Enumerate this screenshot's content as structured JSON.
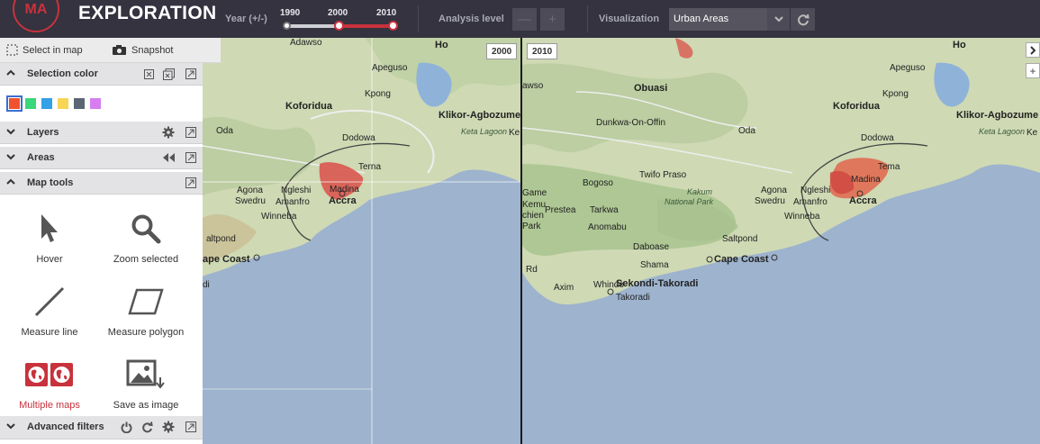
{
  "header": {
    "logo_text": "MA",
    "title": "EXPLORATION",
    "year_label": "Year (+/-)",
    "years": [
      "1990",
      "2000",
      "2010"
    ],
    "analysis_label": "Analysis level",
    "analysis_minus": "—",
    "analysis_plus": "+",
    "visualization_label": "Visualization",
    "visualization_value": "Urban Areas"
  },
  "panel": {
    "select_in_map": "Select in map",
    "snapshot": "Snapshot",
    "sections": {
      "selection_color": "Selection color",
      "layers": "Layers",
      "areas": "Areas",
      "map_tools": "Map tools",
      "advanced_filters": "Advanced filters"
    },
    "swatch_colors": [
      "#f0522e",
      "#3ad77b",
      "#33a0e8",
      "#f7d655",
      "#5b6574",
      "#d67ef0"
    ],
    "tools": [
      {
        "label": "Hover",
        "icon": "pointer-icon"
      },
      {
        "label": "Zoom selected",
        "icon": "magnifier-icon"
      },
      {
        "label": "Measure line",
        "icon": "line-icon"
      },
      {
        "label": "Measure polygon",
        "icon": "polygon-icon"
      },
      {
        "label": "Multiple maps",
        "icon": "globes-icon",
        "active": true
      },
      {
        "label": "Save as image",
        "icon": "image-save-icon"
      }
    ]
  },
  "maps": {
    "left_year": "2000",
    "right_year": "2010",
    "left_labels": [
      "Adawso",
      "Ho",
      "Apeguso",
      "Kpong",
      "Koforidua",
      "Klikor-Agbozume",
      "Keta Lagoon",
      "Ke",
      "Oda",
      "Dodowa",
      "Terna",
      "Agona",
      "Ngleshi",
      "Madina",
      "Swedru",
      "Amanfro",
      "Accra",
      "Winneba",
      "altpond",
      "ape Coast",
      "di"
    ],
    "right_labels": [
      "awso",
      "Ho",
      "Apeguso",
      "Obuasi",
      "Kpong",
      "Koforidua",
      "Klikor-Agbozume",
      "Dunkwa-On-Offin",
      "Keta Lagoon",
      "Ke",
      "Oda",
      "Dodowa",
      "Twifo Praso",
      "Bogoso",
      "Kakum",
      "National Park",
      "Agona",
      "Ngleshi",
      "Madina",
      "Swedru",
      "Amanfro",
      "Tema",
      "Prestea",
      "Tarkwa",
      "Accra",
      "Winneba",
      "Anomabu",
      "Saltpond",
      "Daboase",
      "Shama",
      "Cape Coast",
      "Axim",
      "Whindo",
      "Sekondi-Takoradi",
      "Takoradi",
      "Game",
      "Kemu",
      "chien",
      "Park",
      "Rd"
    ]
  }
}
